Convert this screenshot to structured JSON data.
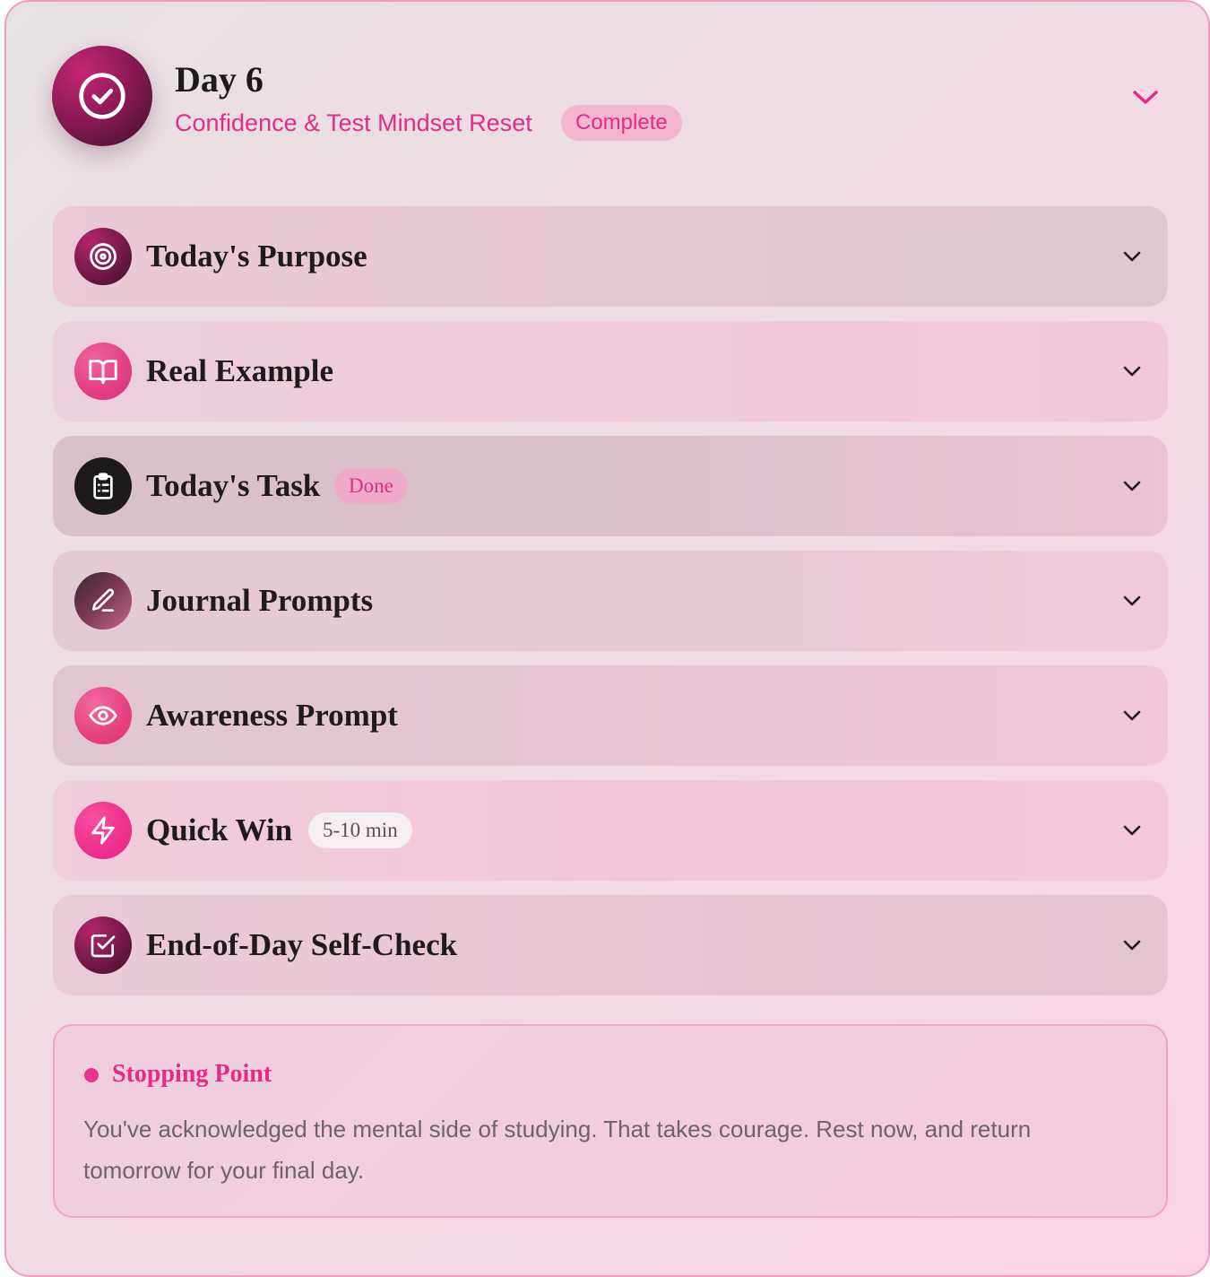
{
  "header": {
    "title": "Day 6",
    "subtitle": "Confidence & Test Mindset Reset",
    "status": "Complete",
    "icon": "check-circle-icon"
  },
  "sections": [
    {
      "label": "Today's Purpose",
      "icon": "target-icon"
    },
    {
      "label": "Real Example",
      "icon": "book-open-icon"
    },
    {
      "label": "Today's Task",
      "icon": "clipboard-list-icon",
      "badge": "Done"
    },
    {
      "label": "Journal Prompts",
      "icon": "pencil-icon"
    },
    {
      "label": "Awareness Prompt",
      "icon": "eye-icon"
    },
    {
      "label": "Quick Win",
      "icon": "lightning-icon",
      "badge": "5-10 min"
    },
    {
      "label": "End-of-Day Self-Check",
      "icon": "checkbox-icon"
    }
  ],
  "stopping_point": {
    "title": "Stopping Point",
    "text": "You've acknowledged the mental side of studying. That takes courage. Rest now, and return tomorrow for your final day."
  },
  "colors": {
    "accent": "#e62a8a",
    "card_border": "#f19ac2",
    "text_dark": "#1d1a1b"
  }
}
